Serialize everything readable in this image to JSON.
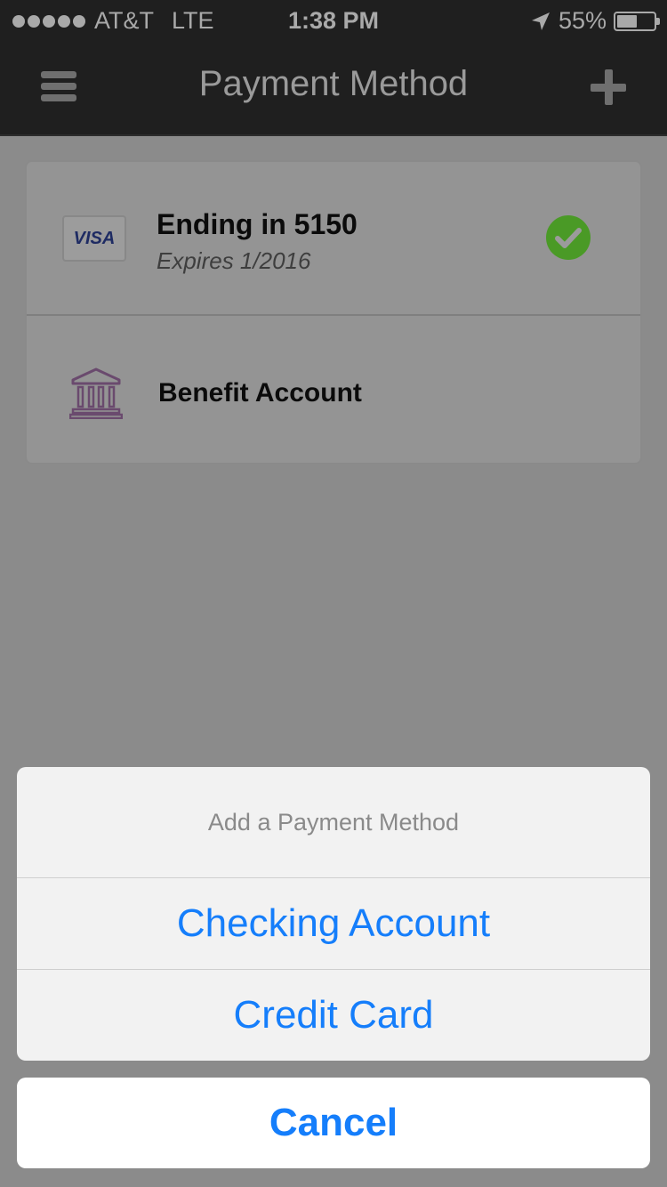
{
  "status_bar": {
    "carrier": "AT&T",
    "network": "LTE",
    "time": "1:38 PM",
    "battery_percent_label": "55%",
    "battery_level": 0.55,
    "signal_icon": "signal-dots-icon",
    "location_icon": "location-arrow-icon"
  },
  "nav": {
    "title": "Payment Method",
    "menu_icon": "hamburger-menu-icon",
    "add_icon": "plus-icon"
  },
  "payment_methods": [
    {
      "logo_text": "VISA",
      "title": "Ending in 5150",
      "subtitle": "Expires 1/2016",
      "selected": true,
      "status_icon": "check-circle-icon"
    },
    {
      "icon": "bank-icon",
      "title": "Benefit Account"
    }
  ],
  "action_sheet": {
    "title": "Add a Payment Method",
    "options": [
      "Checking Account",
      "Credit Card"
    ],
    "cancel_label": "Cancel"
  },
  "colors": {
    "accent_blue": "#157efb",
    "check_green": "#4a9a26",
    "bank_purple": "#6a4a6e",
    "visa_blue": "#1e2b63"
  }
}
